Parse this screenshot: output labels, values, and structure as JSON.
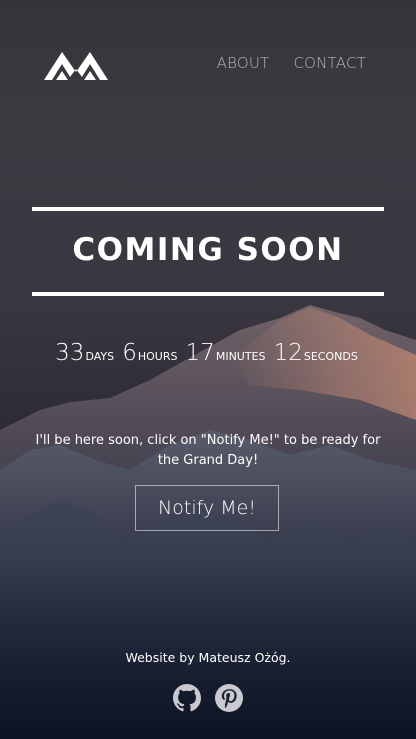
{
  "nav": {
    "items": [
      {
        "label": "ABOUT"
      },
      {
        "label": "CONTACT"
      }
    ]
  },
  "hero": {
    "title": "COMING SOON"
  },
  "countdown": {
    "days": "33",
    "days_label": "DAYS",
    "hours": "6",
    "hours_label": "HOURS",
    "minutes": "17",
    "minutes_label": "MINUTES",
    "seconds": "12",
    "seconds_label": "SECONDS"
  },
  "message": "I'll be here soon, click on \"Notify Me!\" to be ready for the Grand Day!",
  "notify_button": "Notify Me!",
  "footer": {
    "credit": "Website by Mateusz Ożóg.",
    "social": [
      {
        "icon": "github-icon"
      },
      {
        "icon": "pinterest-icon"
      }
    ]
  },
  "colors": {
    "text": "#ffffff",
    "nav_text": "#a8a6aa",
    "background_top": "#36343a",
    "background_bottom": "#0b1324"
  }
}
